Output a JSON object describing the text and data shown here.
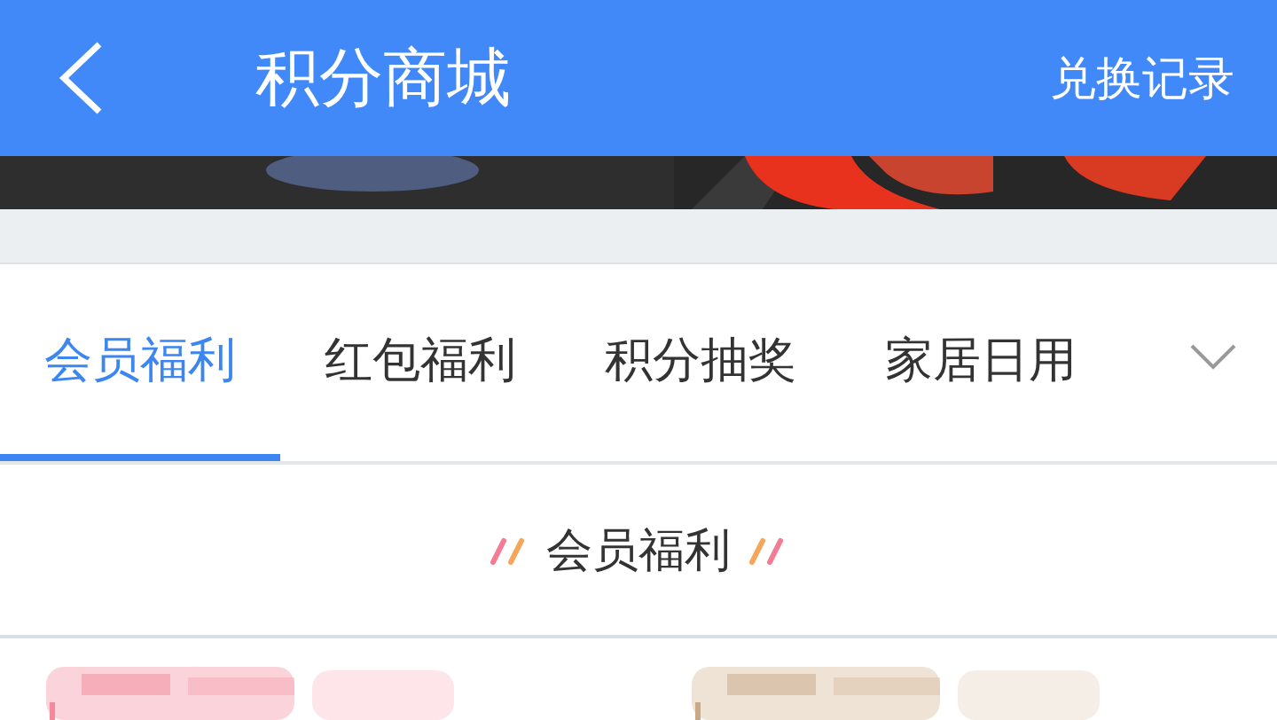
{
  "header": {
    "title": "积分商城",
    "action": "兑换记录"
  },
  "tabs": [
    {
      "label": "会员福利",
      "selected": true
    },
    {
      "label": "红包福利",
      "selected": false
    },
    {
      "label": "积分抽奖",
      "selected": false
    },
    {
      "label": "家居日用",
      "selected": false
    }
  ],
  "section": {
    "title": "会员福利"
  }
}
